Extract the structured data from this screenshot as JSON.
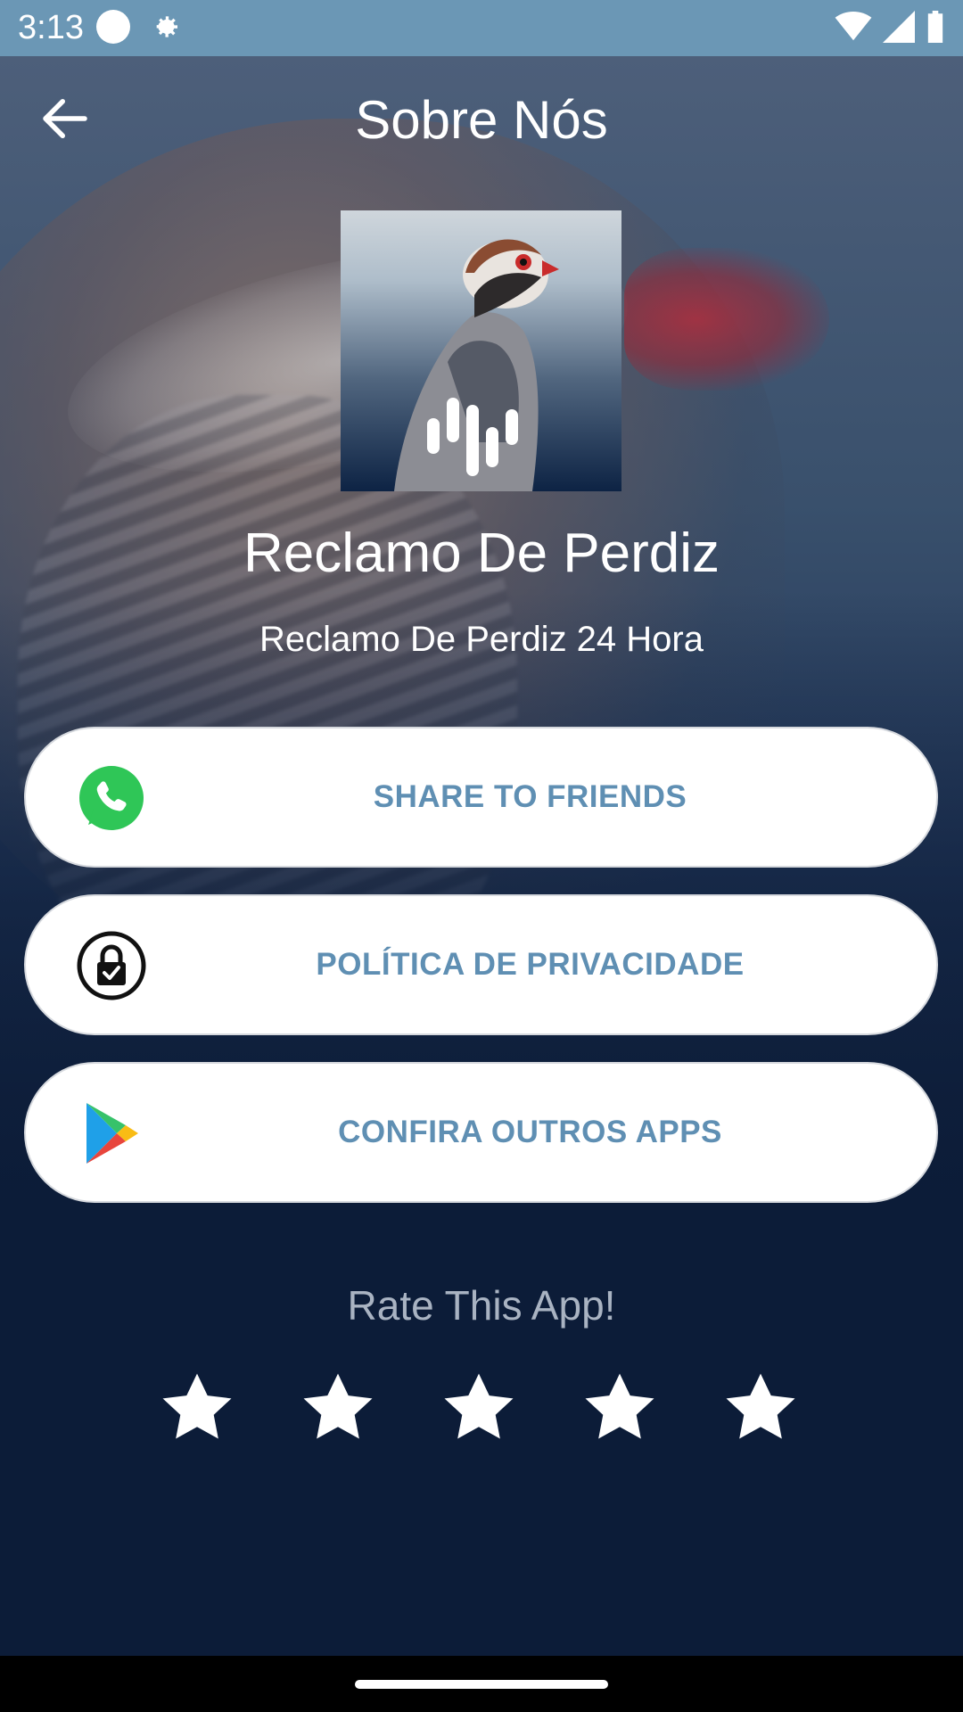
{
  "status_bar": {
    "time": "3:13",
    "icons": [
      "circle-icon",
      "gear-icon",
      "wifi-icon",
      "signal-icon",
      "battery-icon"
    ]
  },
  "header": {
    "title": "Sobre Nós",
    "back_icon": "arrow-left-icon"
  },
  "app": {
    "name": "Reclamo De Perdiz",
    "subtitle": "Reclamo De Perdiz 24 Hora"
  },
  "buttons": [
    {
      "label": "SHARE TO FRIENDS",
      "icon": "whatsapp-icon"
    },
    {
      "label": "POLÍTICA DE PRIVACIDADE",
      "icon": "lock-icon"
    },
    {
      "label": "CONFIRA OUTROS APPS",
      "icon": "play-store-icon"
    }
  ],
  "rating": {
    "title": "Rate This App!",
    "stars_total": 5
  },
  "colors": {
    "status_bar": "#6b97b5",
    "button_text": "#5f8fb3",
    "background_dark": "#0c1c38"
  }
}
